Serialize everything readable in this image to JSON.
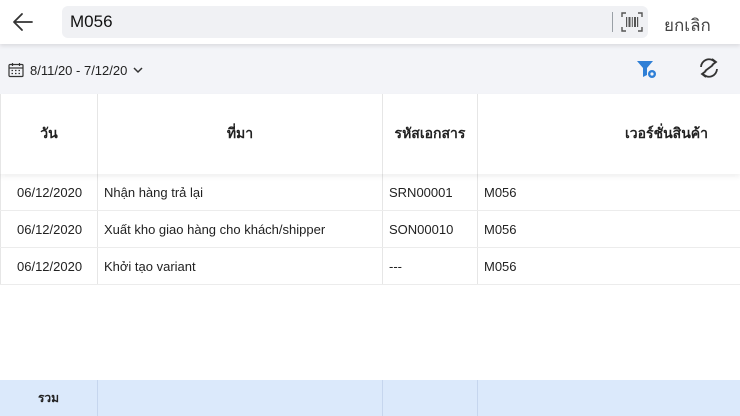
{
  "search": {
    "value": "M056"
  },
  "header": {
    "cancel_label": "ยกเลิก"
  },
  "filter": {
    "date_range": "8/11/20 - 7/12/20"
  },
  "table": {
    "columns": [
      "วัน",
      "ที่มา",
      "รหัสเอกสาร",
      "เวอร์ชั่นสินค้า"
    ],
    "rows": [
      {
        "date": "06/12/2020",
        "source": "Nhận hàng trả lại",
        "doc_code": "SRN00001",
        "variant": "M056"
      },
      {
        "date": "06/12/2020",
        "source": "Xuất kho giao hàng cho khách/shipper",
        "doc_code": "SON00010",
        "variant": "M056"
      },
      {
        "date": "06/12/2020",
        "source": "Khởi tạo variant",
        "doc_code": "---",
        "variant": "M056"
      }
    ]
  },
  "footer": {
    "total_label": "รวม"
  },
  "colors": {
    "accent": "#2f7fd6",
    "footer_bg": "#dbe9fb",
    "filter_bar_bg": "#f3f4f8"
  }
}
